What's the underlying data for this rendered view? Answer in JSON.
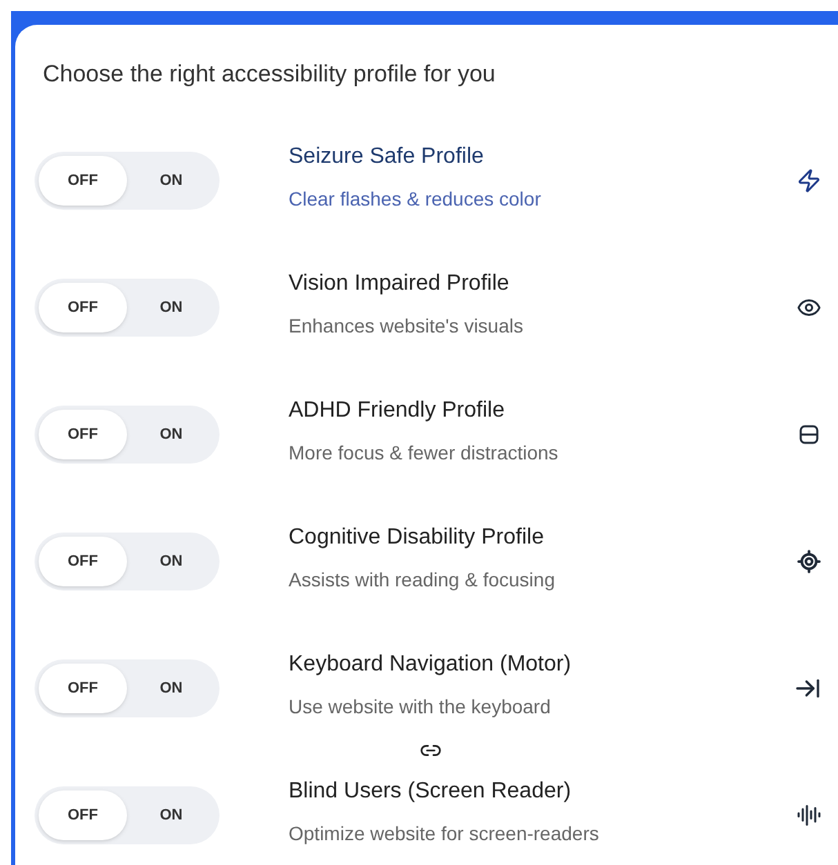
{
  "heading": "Choose the right accessibility profile for you",
  "profiles": [
    {
      "kind": "seizure",
      "title": "Seizure Safe Profile",
      "subtitle": "Clear flashes & reduces color",
      "off_label": "OFF",
      "on_label": "ON",
      "on": false,
      "selected": true
    },
    {
      "kind": "vision",
      "title": "Vision Impaired Profile",
      "subtitle": "Enhances website's visuals",
      "off_label": "OFF",
      "on_label": "ON",
      "on": false,
      "selected": false
    },
    {
      "kind": "adhd",
      "title": "ADHD Friendly Profile",
      "subtitle": "More focus & fewer distractions",
      "off_label": "OFF",
      "on_label": "ON",
      "on": false,
      "selected": false
    },
    {
      "kind": "cognitive",
      "title": "Cognitive Disability Profile",
      "subtitle": "Assists with reading & focusing",
      "off_label": "OFF",
      "on_label": "ON",
      "on": false,
      "selected": false
    },
    {
      "kind": "keyboard",
      "title": "Keyboard Navigation (Motor)",
      "subtitle": "Use website with the keyboard",
      "off_label": "OFF",
      "on_label": "ON",
      "on": false,
      "selected": false
    },
    {
      "kind": "blind",
      "title": "Blind Users (Screen Reader)",
      "subtitle": "Optimize website for screen-readers",
      "off_label": "OFF",
      "on_label": "ON",
      "on": false,
      "selected": false
    }
  ]
}
